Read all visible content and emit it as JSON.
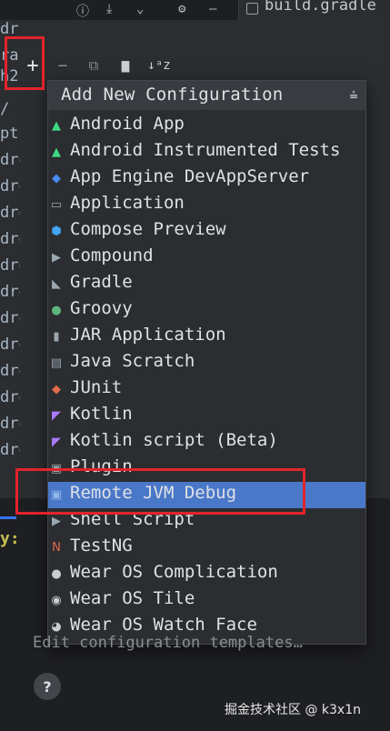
{
  "window": {
    "tab_title": "build.gradle"
  },
  "background": {
    "code_left_fragments": [
      "dr",
      "ra",
      "h2",
      "/",
      "pt",
      "dro",
      "dro",
      "dro",
      "dro",
      "dro",
      "dro",
      "dro",
      "dro",
      "dro",
      "dro",
      "dro",
      "dro"
    ],
    "bottom_code_fragment": "y:"
  },
  "toolbar": {
    "add_glyph": "+",
    "remove_glyph": "−",
    "copy_glyph": "⧉",
    "folder_glyph": "▆",
    "sort_glyph": "↓ᵃz"
  },
  "popup": {
    "title": "Add New Configuration",
    "items": [
      {
        "label": "Android App",
        "icon": "android-icon",
        "color": "#3ddc84"
      },
      {
        "label": "Android Instrumented Tests",
        "icon": "android-test-icon",
        "color": "#3ddc84"
      },
      {
        "label": "App Engine DevAppServer",
        "icon": "app-engine-icon",
        "color": "#4a8af4"
      },
      {
        "label": "Application",
        "icon": "application-icon",
        "color": "#9aa7b0"
      },
      {
        "label": "Compose Preview",
        "icon": "compose-preview-icon",
        "color": "#42a5f5"
      },
      {
        "label": "Compound",
        "icon": "compound-icon",
        "color": "#9aa7b0"
      },
      {
        "label": "Gradle",
        "icon": "gradle-icon",
        "color": "#9aa7b0"
      },
      {
        "label": "Groovy",
        "icon": "groovy-icon",
        "color": "#5fb57d"
      },
      {
        "label": "JAR Application",
        "icon": "jar-icon",
        "color": "#9aa7b0"
      },
      {
        "label": "Java Scratch",
        "icon": "java-scratch-icon",
        "color": "#9aa7b0"
      },
      {
        "label": "JUnit",
        "icon": "junit-icon",
        "color": "#e06c4a"
      },
      {
        "label": "Kotlin",
        "icon": "kotlin-icon",
        "color": "#a97bff"
      },
      {
        "label": "Kotlin script (Beta)",
        "icon": "kotlin-script-icon",
        "color": "#a97bff"
      },
      {
        "label": "Plugin",
        "icon": "plugin-icon",
        "color": "#9aa7b0"
      },
      {
        "label": "Remote JVM Debug",
        "icon": "remote-debug-icon",
        "color": "#8fb8e8",
        "selected": true
      },
      {
        "label": "Shell Script",
        "icon": "shell-script-icon",
        "color": "#9aa7b0"
      },
      {
        "label": "TestNG",
        "icon": "testng-icon",
        "color": "#e06c4a"
      },
      {
        "label": "Wear OS Complication",
        "icon": "wear-complication-icon",
        "color": "#c9ccd1"
      },
      {
        "label": "Wear OS Tile",
        "icon": "wear-tile-icon",
        "color": "#c9ccd1"
      },
      {
        "label": "Wear OS Watch Face",
        "icon": "wear-watchface-icon",
        "color": "#c9ccd1"
      }
    ]
  },
  "footer": {
    "edit_templates": "Edit configuration templates…",
    "help_glyph": "?"
  },
  "watermark": "掘金技术社区 @ k3x1n",
  "colors": {
    "selection": "#4a78c9",
    "highlight_box": "#e2242b",
    "popup_bg": "#2b2d30",
    "header_bg": "#393b40"
  }
}
